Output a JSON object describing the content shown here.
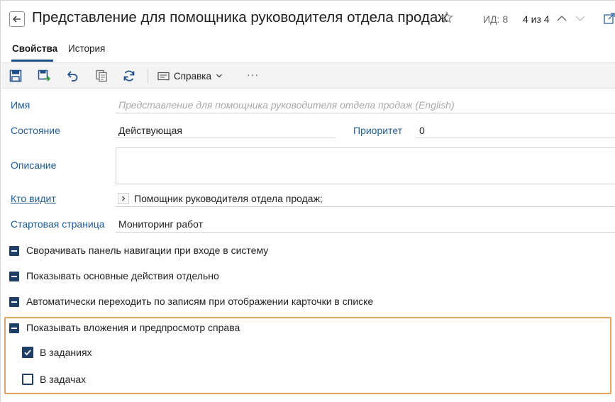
{
  "header": {
    "title": "Представление для помощника руководителя отдела продаж",
    "record_id": "ИД: 8",
    "record_position": "4 из 4"
  },
  "tabs": [
    {
      "label": "Свойства",
      "active": true
    },
    {
      "label": "История",
      "active": false
    }
  ],
  "toolbar": {
    "icons": [
      "save-icon",
      "save-and-close-icon",
      "undo-icon",
      "copy-icon",
      "refresh-icon"
    ],
    "help_label": "Справка",
    "more_label": "···"
  },
  "form": {
    "name": {
      "label": "Имя",
      "placeholder": "Представление для помощника руководителя отдела продаж (English)"
    },
    "state": {
      "label": "Состояние",
      "value": "Действующая"
    },
    "priority": {
      "label": "Приоритет",
      "value": "0"
    },
    "description": {
      "label": "Описание",
      "value": ""
    },
    "visibility": {
      "label": "Кто видит",
      "value": "Помощник руководителя отдела продаж;"
    },
    "start_page": {
      "label": "Стартовая страница",
      "value": "Мониторинг работ"
    }
  },
  "options": [
    {
      "label": "Сворачивать панель навигации при входе в систему"
    },
    {
      "label": "Показывать основные действия отдельно"
    },
    {
      "label": "Автоматически переходить по записям при отображении карточки в списке"
    },
    {
      "label": "Показывать вложения и предпросмотр справа",
      "children": [
        {
          "label": "В заданиях",
          "checked": true
        },
        {
          "label": "В задачах",
          "checked": false
        }
      ]
    }
  ],
  "colors": {
    "accent": "#1e4f8a",
    "label": "#1e5b94",
    "highlight": "#e3a15a"
  }
}
